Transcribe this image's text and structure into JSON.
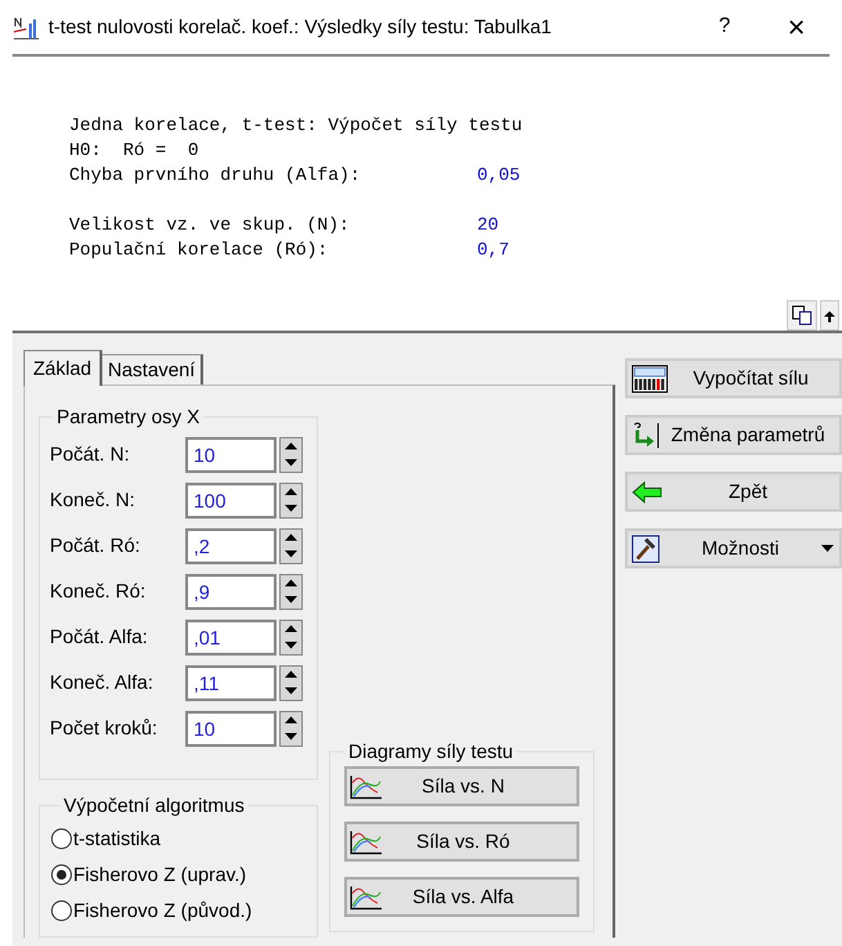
{
  "window": {
    "title": "t-test nulovosti korelač. koef.: Výsledky síly testu: Tabulka1",
    "help": "?",
    "close": "×"
  },
  "report": {
    "heading": "Jedna korelace, t-test: Výpočet síly testu",
    "rows": [
      {
        "label": "H0:  Ró =  0",
        "value": ""
      },
      {
        "label": "Chyba prvního druhu (Alfa):",
        "value": "0,05"
      },
      {
        "label": "",
        "value": ""
      },
      {
        "label": "Velikost vz. ve skup. (N):",
        "value": "20"
      },
      {
        "label": "Populační korelace (Ró):",
        "value": "0,7"
      }
    ]
  },
  "tabs": [
    {
      "label": "Základ",
      "selected": true
    },
    {
      "label": "Nastavení",
      "selected": false
    }
  ],
  "axis_group": {
    "title": "Parametry osy X",
    "fields": [
      {
        "label": "Počát. N:",
        "value": "10"
      },
      {
        "label": "Koneč. N:",
        "value": "100"
      },
      {
        "label": "Počát. Ró:",
        "value": ",2"
      },
      {
        "label": "Koneč. Ró:",
        "value": ",9"
      },
      {
        "label": "Počát. Alfa:",
        "value": ",01"
      },
      {
        "label": "Koneč. Alfa:",
        "value": ",11"
      },
      {
        "label": "Počet kroků:",
        "value": "10"
      }
    ]
  },
  "algorithm_group": {
    "title": "Výpočetní algoritmus",
    "options": [
      {
        "label": "t-statistika",
        "selected": false
      },
      {
        "label": "Fisherovo Z (uprav.)",
        "selected": true
      },
      {
        "label": "Fisherovo Z (původ.)",
        "selected": false
      }
    ]
  },
  "diagram_group": {
    "title": "Diagramy síly testu",
    "buttons": [
      "Síla vs. N",
      "Síla vs. Ró",
      "Síla vs. Alfa"
    ]
  },
  "actions": [
    {
      "kind": "calc",
      "label": "Vypočítat sílu"
    },
    {
      "kind": "change",
      "label": "Změna parametrů"
    },
    {
      "kind": "back",
      "label": "Zpět"
    },
    {
      "kind": "menu",
      "label": "Možnosti"
    }
  ]
}
